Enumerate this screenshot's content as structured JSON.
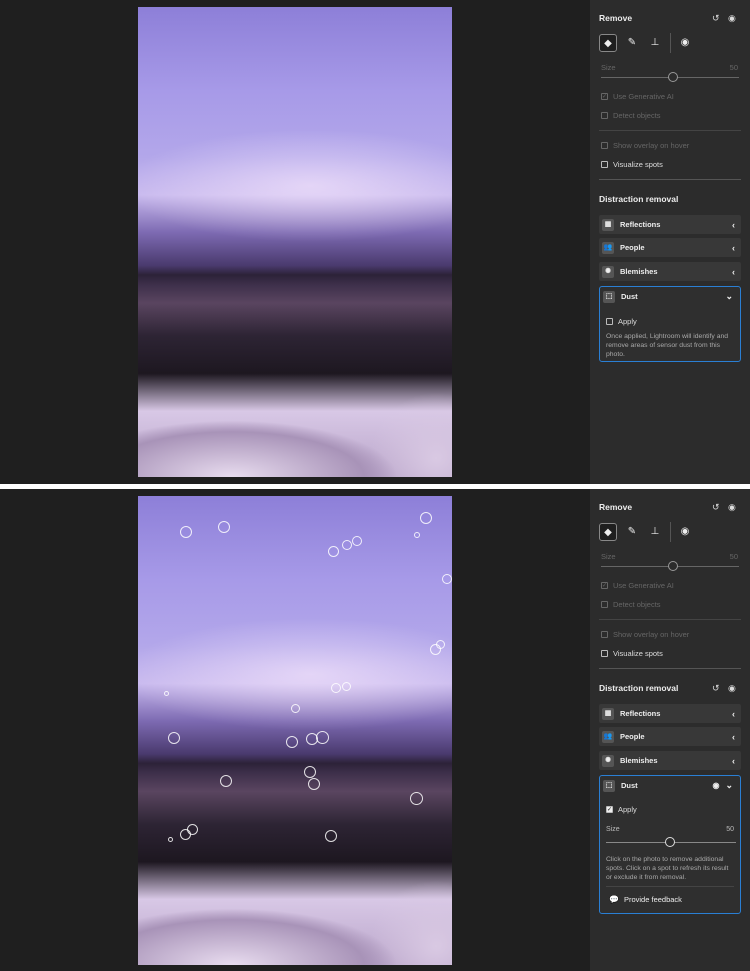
{
  "top": {
    "remove": {
      "title": "Remove",
      "size_label": "Size",
      "size_value": "50",
      "use_gen_ai": "Use Generative AI",
      "detect_objects": "Detect objects",
      "show_overlay": "Show overlay on hover",
      "visualize_spots": "Visualize spots"
    },
    "distraction": {
      "title": "Distraction removal",
      "items": [
        {
          "label": "Reflections"
        },
        {
          "label": "People"
        },
        {
          "label": "Blemishes"
        }
      ],
      "dust": {
        "label": "Dust",
        "apply": "Apply",
        "apply_checked": false,
        "description": "Once applied, Lightroom will identify and remove areas of sensor dust from this photo."
      }
    }
  },
  "bottom": {
    "remove": {
      "title": "Remove",
      "size_label": "Size",
      "size_value": "50",
      "use_gen_ai": "Use Generative AI",
      "detect_objects": "Detect objects",
      "show_overlay": "Show overlay on hover",
      "visualize_spots": "Visualize spots"
    },
    "distraction": {
      "title": "Distraction removal",
      "items": [
        {
          "label": "Reflections"
        },
        {
          "label": "People"
        },
        {
          "label": "Blemishes"
        }
      ],
      "dust": {
        "label": "Dust",
        "apply": "Apply",
        "apply_checked": true,
        "size_label": "Size",
        "size_value": "50",
        "description": "Click on the photo to remove additional spots. Click on a spot to refresh its result or exclude it from removal.",
        "feedback": "Provide feedback"
      }
    }
  },
  "colors": {
    "accent": "#2a7fd4",
    "panel": "#2c2c2c",
    "background": "#1f1f1f"
  }
}
